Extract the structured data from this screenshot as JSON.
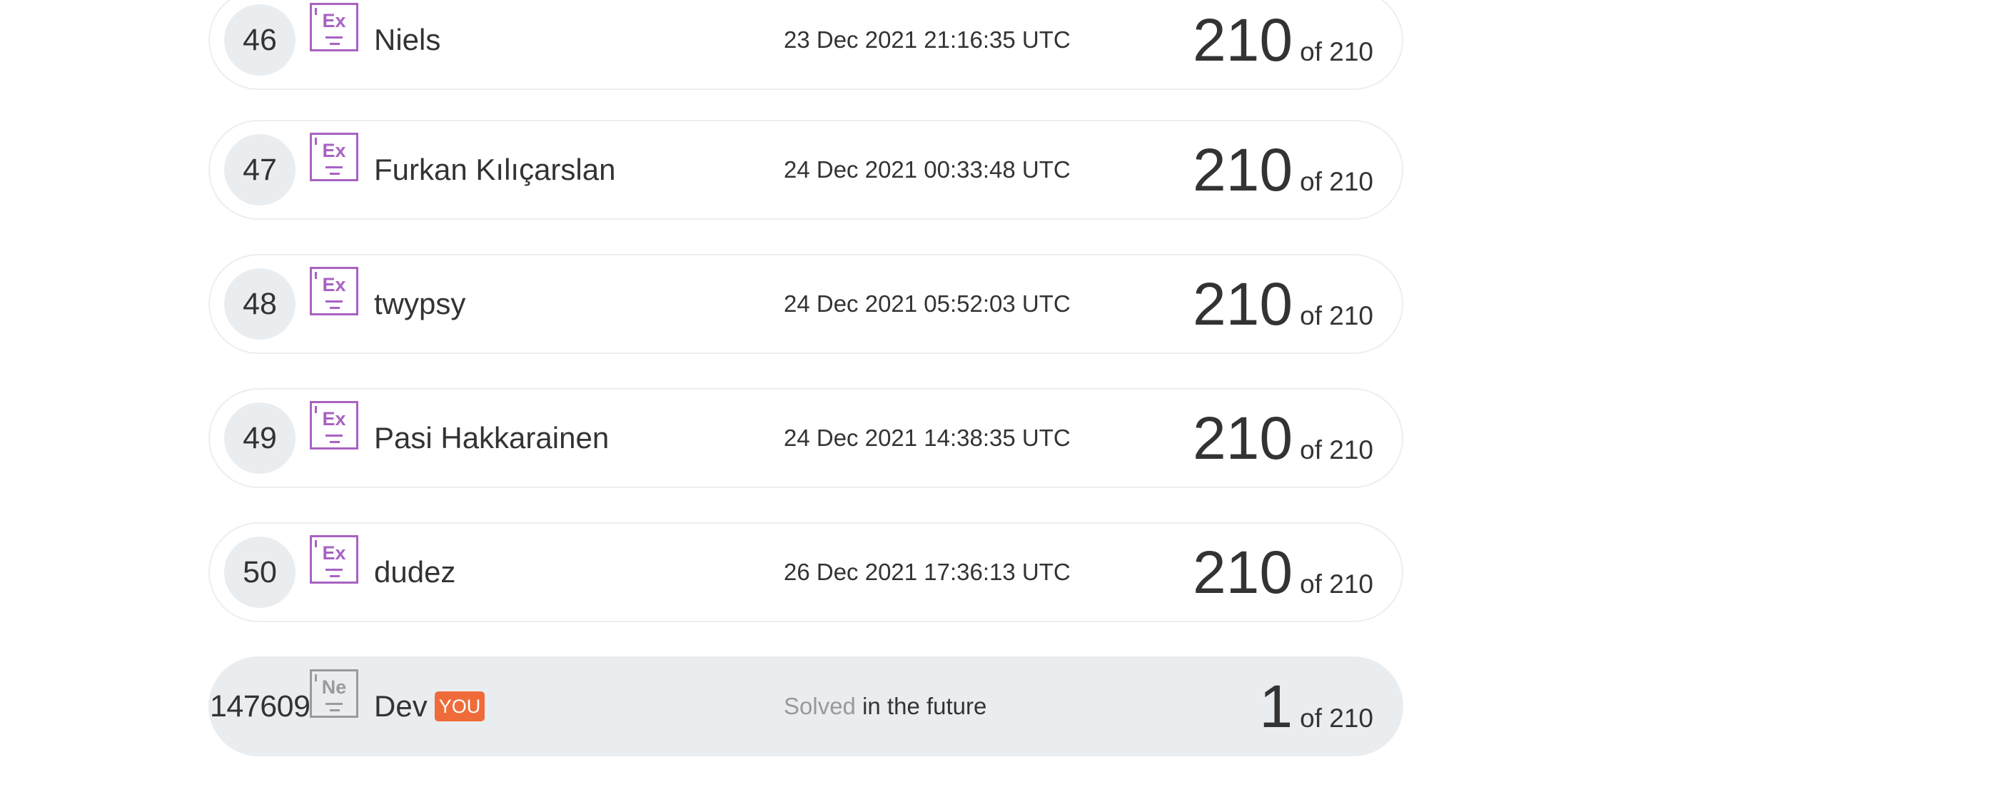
{
  "leaderboard": {
    "rows": [
      {
        "rank": "46",
        "badge": "Ex",
        "name": "Niels",
        "time": "23 Dec 2021 21:16:35 UTC",
        "score": "210",
        "total": "of 210"
      },
      {
        "rank": "47",
        "badge": "Ex",
        "name": "Furkan Kılıçarslan",
        "time": "24 Dec 2021 00:33:48 UTC",
        "score": "210",
        "total": "of 210"
      },
      {
        "rank": "48",
        "badge": "Ex",
        "name": "twypsy",
        "time": "24 Dec 2021 05:52:03 UTC",
        "score": "210",
        "total": "of 210"
      },
      {
        "rank": "49",
        "badge": "Ex",
        "name": "Pasi Hakkarainen",
        "time": "24 Dec 2021 14:38:35 UTC",
        "score": "210",
        "total": "of 210"
      },
      {
        "rank": "50",
        "badge": "Ex",
        "name": "dudez",
        "time": "26 Dec 2021 17:36:13 UTC",
        "score": "210",
        "total": "of 210"
      }
    ],
    "current_user": {
      "rank": "147609",
      "badge": "Ne",
      "name": "Dev",
      "you_label": "YOU",
      "solved_label": "Solved",
      "time": "in the future",
      "score": "1",
      "total": "of 210"
    }
  },
  "colors": {
    "expert_badge": "#a862c2",
    "newbie_badge": "#9a9a9a",
    "you_tag": "#ef6c3a",
    "rank_circle": "#e9edf0",
    "current_row_bg": "#eaedf0"
  },
  "icons": {
    "expert_badge": "expert-level-badge-icon",
    "newbie_badge": "newbie-level-badge-icon"
  }
}
